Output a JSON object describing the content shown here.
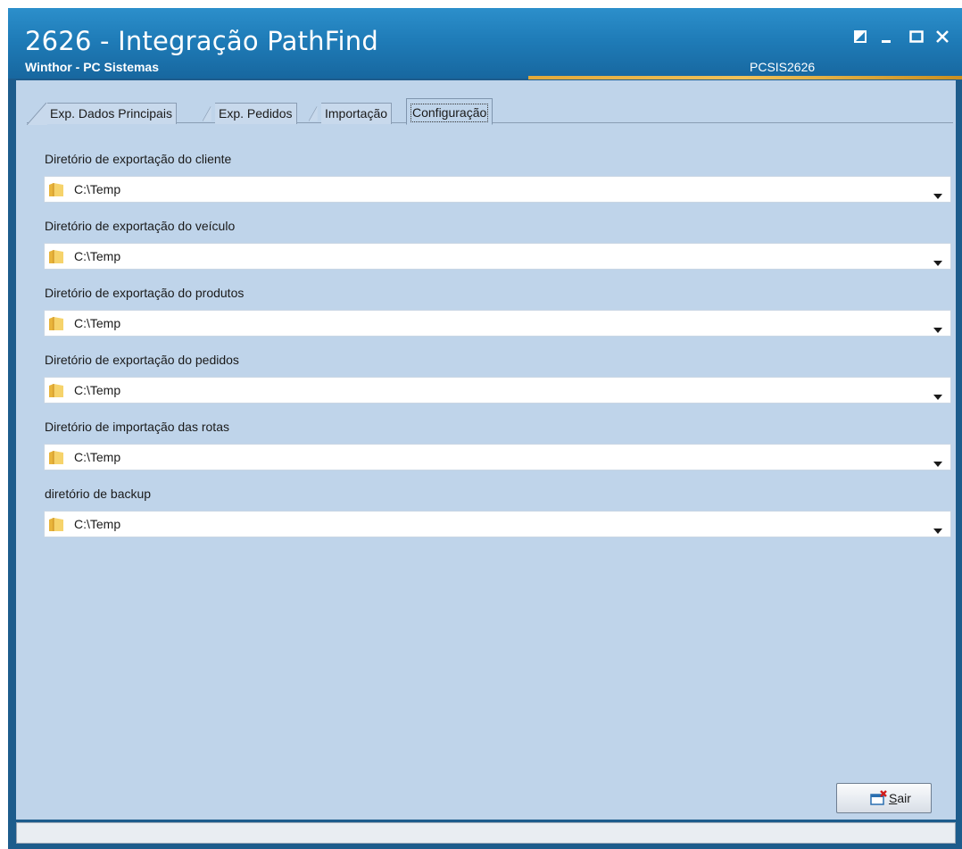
{
  "window": {
    "title": "2626 - Integração PathFind",
    "subtitle": "Winthor - PC Sistemas",
    "routine_code": "PCSIS2626"
  },
  "tabs": [
    {
      "label": "Exp. Dados Principais",
      "active": false
    },
    {
      "label": "Exp. Pedidos",
      "active": false
    },
    {
      "label": "Importação",
      "active": false
    },
    {
      "label": "Configuração",
      "active": true
    }
  ],
  "fields": [
    {
      "label": "Diretório de exportação do cliente",
      "value": "C:\\Temp"
    },
    {
      "label": "Diretório de exportação do veículo",
      "value": "C:\\Temp"
    },
    {
      "label": "Diretório de exportação do produtos",
      "value": "C:\\Temp"
    },
    {
      "label": "Diretório de exportação do pedidos",
      "value": "C:\\Temp"
    },
    {
      "label": "Diretório de importação das rotas",
      "value": "C:\\Temp"
    },
    {
      "label": "diretório de backup",
      "value": "C:\\Temp"
    }
  ],
  "buttons": {
    "sair_mnemonic": "S",
    "sair_rest": "air"
  },
  "icons": {
    "restore": "restore-icon",
    "minimize": "minimize-icon",
    "maximize": "maximize-icon",
    "close": "close-icon",
    "folder": "folder-icon",
    "dropdown": "chevron-down-icon",
    "exit": "exit-icon"
  },
  "colors": {
    "titlebar": "#1f7cb8",
    "panel": "#bfd4ea",
    "accent_strip": "#e2a93a"
  }
}
